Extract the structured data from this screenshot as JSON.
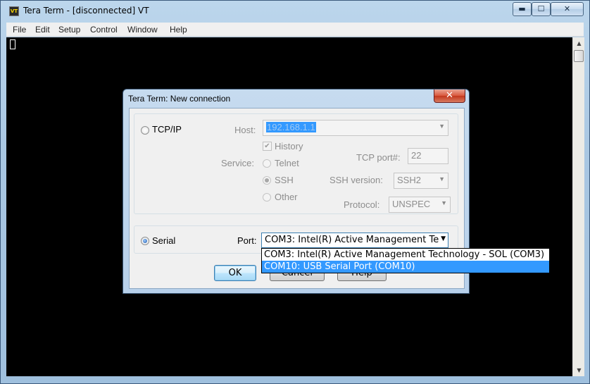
{
  "window": {
    "title": "Tera Term - [disconnected] VT",
    "icon_text": "VT",
    "minimize_glyph": "▬",
    "maximize_glyph": "☐",
    "close_glyph": "✕"
  },
  "menubar": {
    "items": [
      "File",
      "Edit",
      "Setup",
      "Control",
      "Window",
      "Help"
    ]
  },
  "scrollbar": {
    "up_glyph": "▲",
    "down_glyph": "▼"
  },
  "dialog": {
    "title": "Tera Term: New connection",
    "close_glyph": "✕",
    "tcpip": {
      "radio_label": "TCP/IP",
      "selected": false,
      "host_label": "Host:",
      "host_value": "192.168.1.1",
      "history_label": "History",
      "history_checked": true,
      "service_label": "Service:",
      "services": [
        "Telnet",
        "SSH",
        "Other"
      ],
      "service_selected": "SSH",
      "tcpport_label": "TCP port#:",
      "tcpport_value": "22",
      "sshver_label": "SSH version:",
      "sshver_value": "SSH2",
      "protocol_label": "Protocol:",
      "protocol_value": "UNSPEC"
    },
    "serial": {
      "radio_label": "Serial",
      "selected": true,
      "port_label": "Port:",
      "port_value": "COM3: Intel(R) Active Management Te",
      "options": [
        "COM3: Intel(R) Active Management Technology - SOL (COM3)",
        "COM10: USB Serial Port (COM10)"
      ],
      "highlighted_index": 1
    },
    "buttons": {
      "ok": "OK",
      "cancel": "Cancel",
      "help": "Help"
    }
  },
  "colors": {
    "terminal_bg": "#000000",
    "selection": "#3399ff",
    "dialog_frame": "#b7d0ea"
  }
}
